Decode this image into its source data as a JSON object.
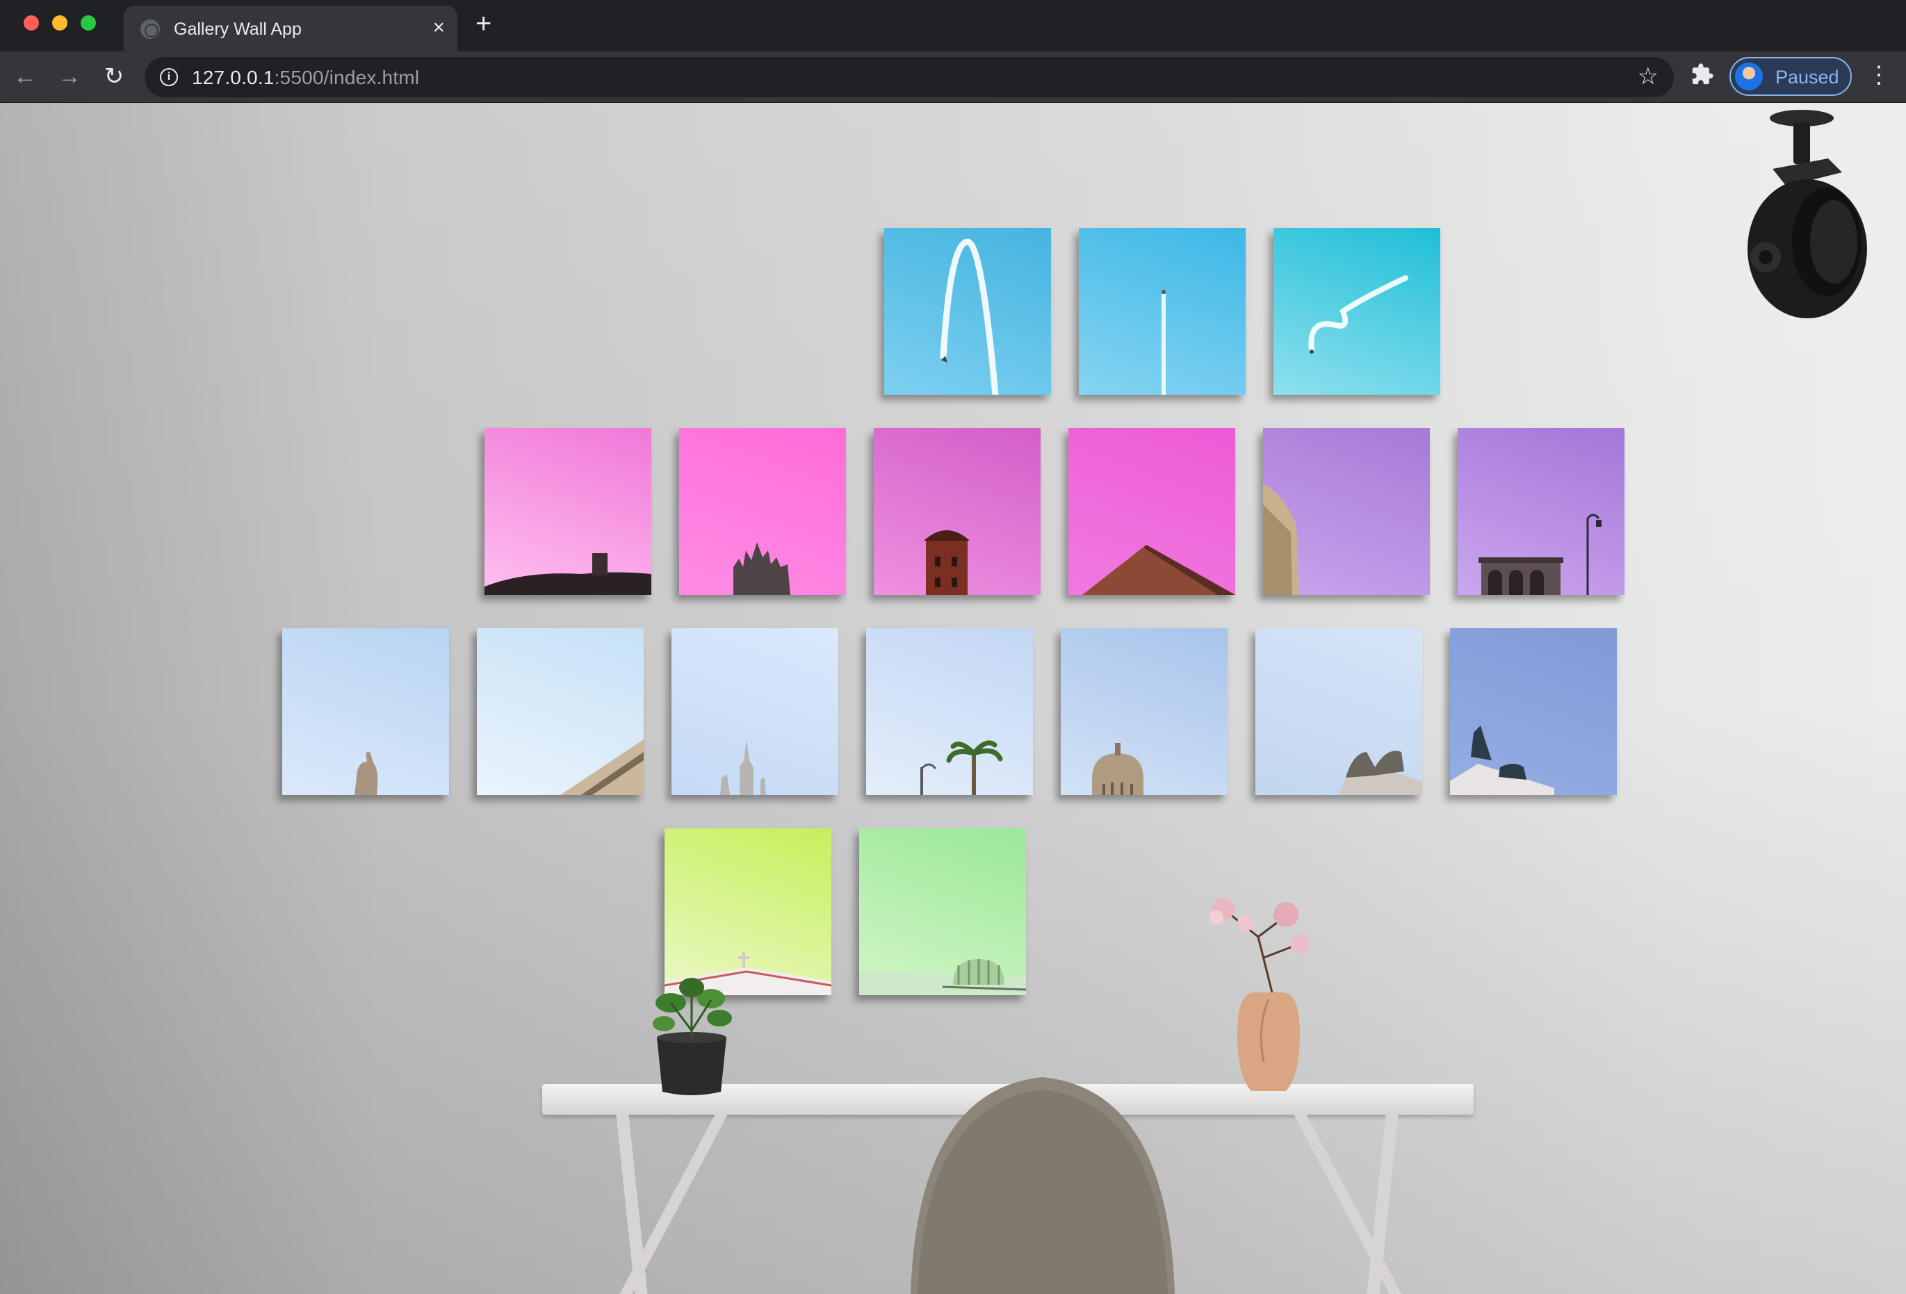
{
  "browser": {
    "tab_title": "Gallery Wall App",
    "tab_close": "×",
    "new_tab": "+",
    "url_host": "127.0.0.1",
    "url_rest": ":5500/index.html",
    "profile_label": "Paused"
  },
  "gallery": {
    "rows": [
      {
        "frames": [
          {
            "name": "photo-skywriting-loop",
            "sky": [
              "#45b4e0",
              "#7cd0f0"
            ]
          },
          {
            "name": "photo-jet-contrail",
            "sky": [
              "#3cb8e6",
              "#86d4f2"
            ]
          },
          {
            "name": "photo-skywriting-curve",
            "sky": [
              "#1fbfd8",
              "#8ee0ee"
            ]
          }
        ]
      },
      {
        "frames": [
          {
            "name": "photo-hill-tower",
            "sky": [
              "#f078d8",
              "#ffc0f0"
            ]
          },
          {
            "name": "photo-gothic-spire",
            "sky": [
              "#ff6cd8",
              "#ff8ce4"
            ]
          },
          {
            "name": "photo-brick-tower",
            "sky": [
              "#d35fc8",
              "#ee90e0"
            ]
          },
          {
            "name": "photo-brick-gable",
            "sky": [
              "#ee5ad6",
              "#f07ae0"
            ]
          },
          {
            "name": "photo-dome-edge",
            "sky": [
              "#a57bd6",
              "#c8a4ee"
            ]
          },
          {
            "name": "photo-streetlamp-ruin",
            "sky": [
              "#a377d8",
              "#cba6ee"
            ]
          }
        ]
      },
      {
        "frames": [
          {
            "name": "photo-equestrian-statue",
            "sky": [
              "#b8d4f2",
              "#dbe9fa"
            ]
          },
          {
            "name": "photo-building-corner",
            "sky": [
              "#c6e1f6",
              "#eaf4fc"
            ]
          },
          {
            "name": "photo-church-spire",
            "sky": [
              "#dae8fa",
              "#c6daf6"
            ]
          },
          {
            "name": "photo-palm-lamp",
            "sky": [
              "#c2d6f4",
              "#e4eefa"
            ]
          },
          {
            "name": "photo-baroque-dome",
            "sky": [
              "#a8c4ec",
              "#d2e2f6"
            ]
          },
          {
            "name": "photo-chariot-statue",
            "sky": [
              "#d6e4f6",
              "#c2d6f0"
            ]
          },
          {
            "name": "photo-rooftop-statue",
            "sky": [
              "#7f9ad8",
              "#95aee2"
            ]
          }
        ]
      },
      {
        "frames": [
          {
            "name": "photo-cross-roof",
            "sky": [
              "#c6f05a",
              "#eaf8c6"
            ]
          },
          {
            "name": "photo-green-dome",
            "sky": [
              "#9ae898",
              "#d2f6c6"
            ]
          }
        ]
      }
    ]
  }
}
